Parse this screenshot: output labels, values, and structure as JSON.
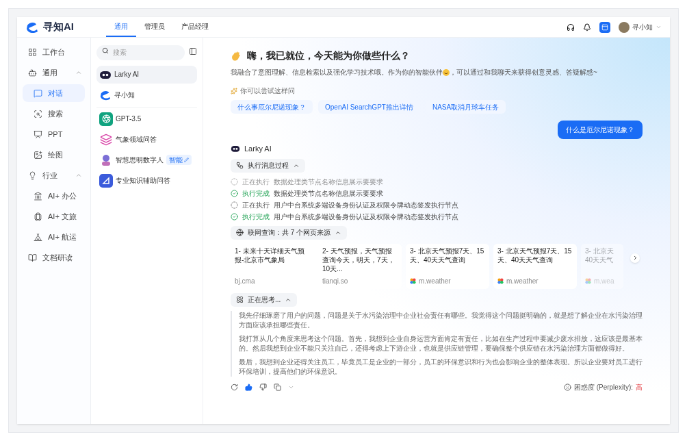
{
  "brand": {
    "name": "寻知AI"
  },
  "top_tabs": [
    {
      "label": "通用",
      "selected": true
    },
    {
      "label": "管理员",
      "selected": false
    },
    {
      "label": "产品经理",
      "selected": false
    }
  ],
  "user": {
    "name": "寻小知"
  },
  "nav": [
    {
      "label": "工作台",
      "selected": false
    },
    {
      "label": "通用",
      "expanded": true,
      "children": [
        {
          "label": "对话",
          "selected": true
        },
        {
          "label": "搜索",
          "selected": false
        },
        {
          "label": "PPT",
          "selected": false
        },
        {
          "label": "绘图",
          "selected": false
        }
      ]
    },
    {
      "label": "行业",
      "expanded": true,
      "children": [
        {
          "label": "AI+ 办公",
          "selected": false
        },
        {
          "label": "AI+ 文旅",
          "selected": false
        },
        {
          "label": "AI+ 航运",
          "selected": false
        }
      ]
    },
    {
      "label": "文档研读",
      "selected": false
    }
  ],
  "assistant_search": {
    "placeholder": "搜索"
  },
  "assistant_groups": [
    {
      "items": [
        {
          "name": "Larky AI",
          "selected": true
        },
        {
          "name": "寻小知",
          "selected": false
        }
      ]
    },
    {
      "items": [
        {
          "name": "GPT-3.5",
          "selected": false
        },
        {
          "name": "气象领域问答",
          "selected": false
        },
        {
          "name": "智慧思明数字人",
          "selected": false,
          "badge": "智能"
        },
        {
          "name": "专业知识辅助问答",
          "selected": false
        }
      ]
    }
  ],
  "greeting": {
    "title": "嗨，我已就位，今天能为你做些什么？",
    "intro_before": "我融合了意图理解、信息检索以及强化学习技术哦。作为你的智能伙伴",
    "intro_after": "，可以通过和我聊天来获得创意灵感、答疑解惑~"
  },
  "suggestions": {
    "label": "你可以尝试这样问",
    "items": [
      "什么事厄尔尼诺现象？",
      "OpenAI SearchGPT推出详情",
      "NASA取消月球车任务"
    ]
  },
  "user_message": "什么是厄尔尼诺现象？",
  "answer": {
    "bot_name": "Larky AI",
    "process": {
      "label": "执行消息过程",
      "expanded": true
    },
    "steps": [
      {
        "kind": "running",
        "faded": true,
        "label": "正在执行",
        "text": "数据处理类节点名称信息展示要要求"
      },
      {
        "kind": "done",
        "faded": false,
        "label": "执行完成",
        "text": "数据处理类节点名称信息展示要要求"
      },
      {
        "kind": "running",
        "faded": false,
        "label": "正在执行",
        "text": "用户中台系统多端设备身份认证及权限令牌动态签发执行节点"
      },
      {
        "kind": "done",
        "faded": false,
        "label": "执行完成",
        "text": "用户中台系统多端设备身份认证及权限令牌动态签发执行节点"
      }
    ],
    "sources_header": {
      "label": "联网查询：共 7 个网页来源",
      "expanded": true
    },
    "sources": [
      {
        "kind": "plain",
        "faded": false,
        "title": "1- 未来十天详细天气预报-北京市气象局",
        "site": "bj.cma"
      },
      {
        "kind": "plain",
        "faded": false,
        "title": "2- 天气预报，天气预报查询今天，明天，7天，10天...",
        "site": "tianqi.so"
      },
      {
        "kind": "favicon",
        "faded": false,
        "title": "3- 北京天气预报7天、15天、40天天气查询",
        "site": "m.weather"
      },
      {
        "kind": "favicon",
        "faded": false,
        "title": "3- 北京天气预报7天、15天、40天天气查询",
        "site": "m.weather"
      },
      {
        "kind": "favicon",
        "faded": true,
        "title": "3- 北京天 40天天气",
        "site": "m.wea"
      }
    ],
    "thinking": {
      "label": "正在思考...",
      "expanded": true
    },
    "thoughts": [
      "我先仔细琢磨了用户的问题，问题是关于水污染治理中企业社会责任有哪些。我觉得这个问题挺明确的，就是想了解企业在水污染治理方面应该承担哪些责任。",
      "我打算从几个角度来思考这个问题。首先，我想到企业自身运营方面肯定有责任，比如在生产过程中要减少废水排放，这应该是最基本的。然后我想到企业不能只关注自己，还得考虑上下游企业，也就是供应链管理，要确保整个供应链在水污染治理方面都做得好。",
      "最后，我想到企业还得关注员工，毕竟员工是企业的一部分，员工的环保意识和行为也会影响企业的整体表现。所以企业要对员工进行环保培训，提高他们的环保意识。"
    ],
    "feedback": {
      "liked": true,
      "disliked": false
    },
    "perplexity": {
      "label": "困惑度 (Perplexity):",
      "value": "高"
    }
  }
}
